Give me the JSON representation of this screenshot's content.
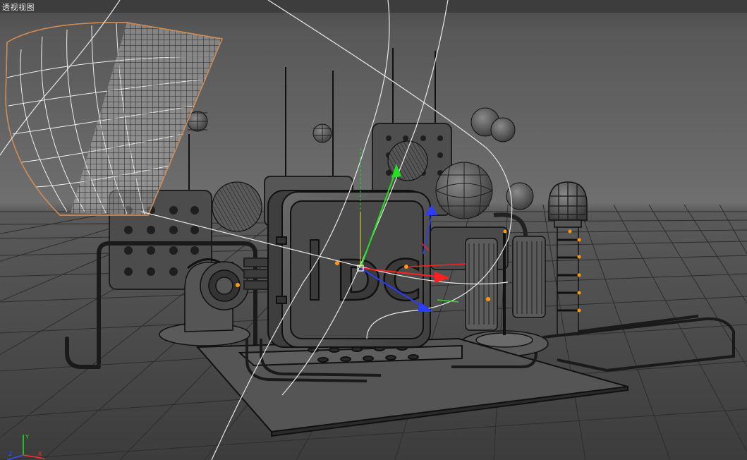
{
  "viewport": {
    "title": "透视视图",
    "background_top": "#5a5a5a",
    "background_mid": "#6e6e6e",
    "floor_color": "#4a4a4a",
    "grid_color": "#2e2e2e"
  },
  "scene_text": {
    "letters": "DC"
  },
  "gizmo": {
    "x_color": "#ff2020",
    "y_color": "#20e020",
    "z_color": "#2a3cff",
    "point_color": "#ff9a10"
  },
  "axis_indicator": {
    "y_label": "Y",
    "x_label": "X",
    "z_label": "Z"
  }
}
